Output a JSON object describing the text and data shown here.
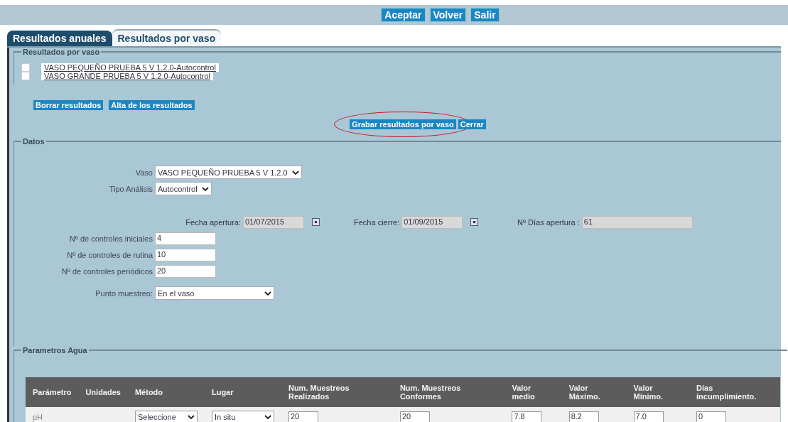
{
  "top_buttons": [
    "Aceptar",
    "Volver",
    "Salir"
  ],
  "tabs": [
    {
      "label": "Resultados anuales",
      "selected": true
    },
    {
      "label": "Resultados por vaso",
      "selected": false
    }
  ],
  "vasos_section": {
    "legend": "Resultados por vaso",
    "items": [
      {
        "label": "VASO PEQUEÑO PRUEBA 5 V 1.2.0-Autocontrol",
        "checked": false
      },
      {
        "label": "VASO GRANDE PRUEBA 5 V 1.2.0-Autocontrol",
        "checked": false
      }
    ]
  },
  "action_buttons": [
    "Borrar resultados",
    "Alta de los resultados"
  ],
  "save_buttons": [
    {
      "label": "Grabar resultados por vaso",
      "circled": true
    },
    {
      "label": "Cerrar",
      "circled": false
    }
  ],
  "datos": {
    "legend": "Datos",
    "selects": [
      {
        "label": "Vaso",
        "value": "VASO PEQUEÑO PRUEBA 5 V 1.2.0"
      },
      {
        "label": "Tipo Análisis",
        "value": "Autocontrol"
      }
    ],
    "dates": [
      {
        "label": "Fecha apertura:",
        "value": "01/07/2015",
        "readonly": true,
        "kind": "date"
      },
      {
        "label": "Fecha cierre:",
        "value": "01/09/2015",
        "readonly": true,
        "kind": "date"
      },
      {
        "label": "Nº Días apertura :",
        "value": "61",
        "readonly": true,
        "kind": "text"
      }
    ],
    "controles": [
      {
        "label": "Nº de controles iniciales",
        "value": "4",
        "readonly": false
      },
      {
        "label": "Nº de controles de rutina",
        "value": "10",
        "readonly": false
      },
      {
        "label": "Nº de controles periódicos",
        "value": "20",
        "readonly": false
      }
    ],
    "punto": {
      "label": "Punto muestreo:",
      "value": "En el vaso"
    }
  },
  "parametros": {
    "legend": "Parametros Agua",
    "columns": [
      "Parámetro",
      "Unidades",
      "Método",
      "Lugar",
      "Num. Muestreos Realizados",
      "Num. Muestreos Conformes",
      "Valor medio",
      "Valor Máximo.",
      "Valor Mínimo.",
      "Días incumplimiento."
    ],
    "rows": [
      {
        "parametro": "pH",
        "metodo": "Seleccione",
        "lugar": "In situ",
        "values": [
          "20",
          "20",
          "7.8",
          "8.2",
          "7.0",
          "0"
        ]
      }
    ]
  }
}
